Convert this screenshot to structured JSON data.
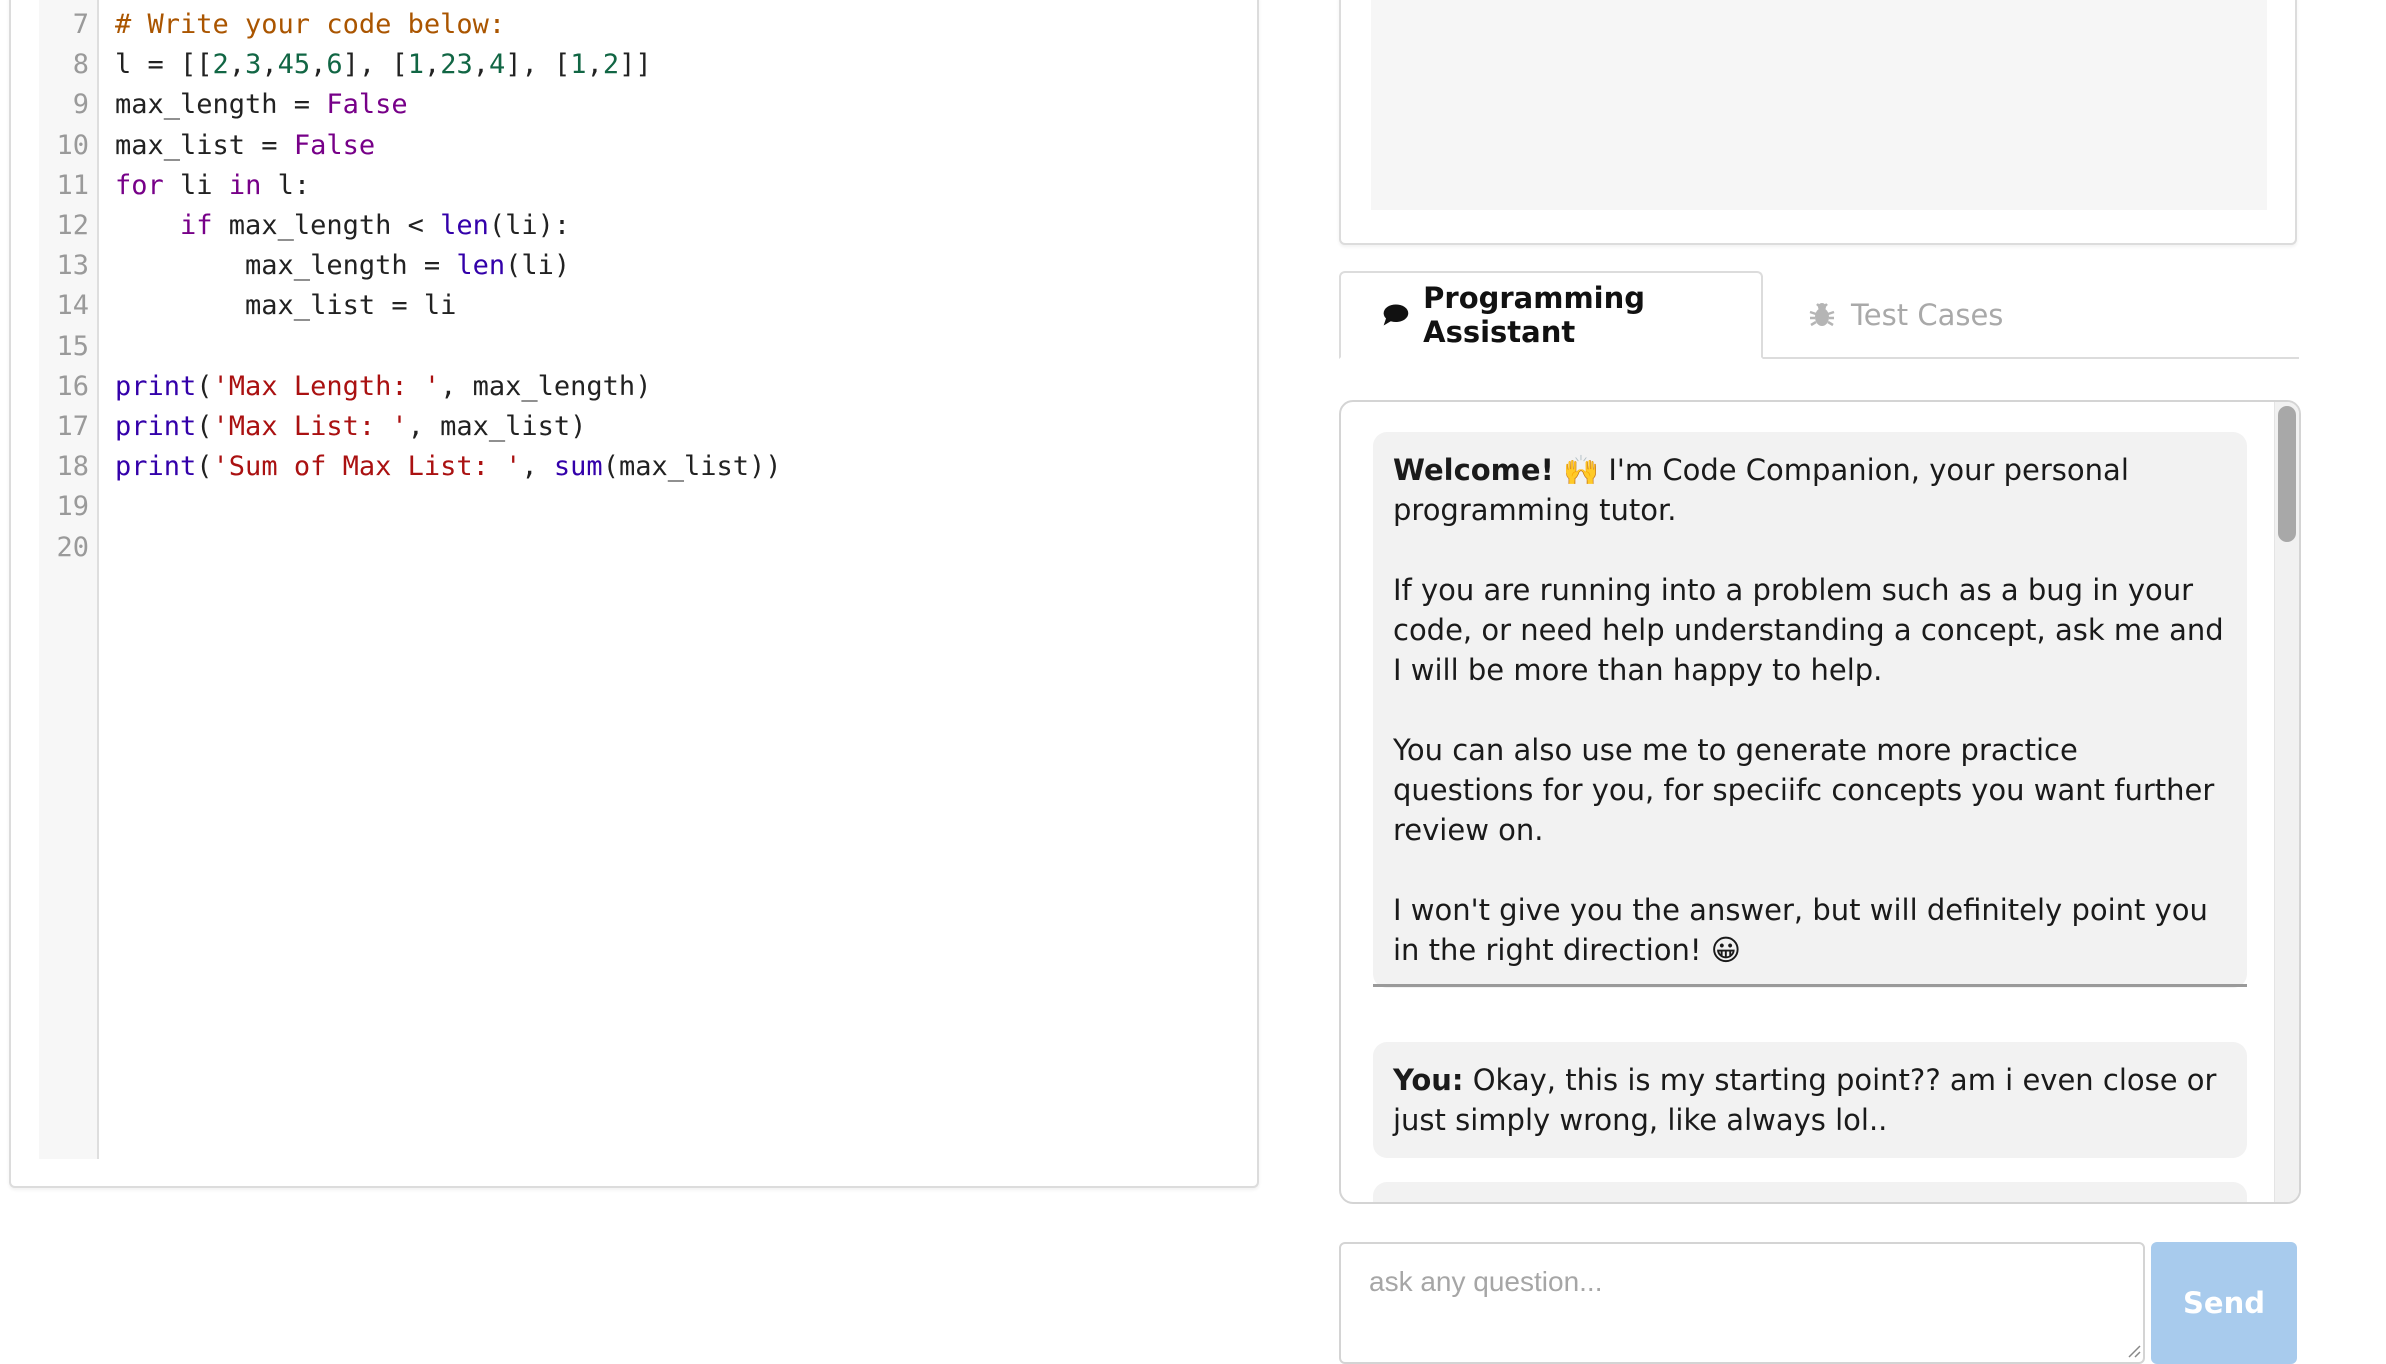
{
  "editor": {
    "lines": [
      {
        "n": "7",
        "tokens": [
          {
            "t": "# Write your code below:",
            "c": "comment"
          }
        ]
      },
      {
        "n": "8",
        "tokens": [
          {
            "t": "l = [[",
            "c": "var"
          },
          {
            "t": "2",
            "c": "number"
          },
          {
            "t": ",",
            "c": "var"
          },
          {
            "t": "3",
            "c": "number"
          },
          {
            "t": ",",
            "c": "var"
          },
          {
            "t": "45",
            "c": "number"
          },
          {
            "t": ",",
            "c": "var"
          },
          {
            "t": "6",
            "c": "number"
          },
          {
            "t": "], [",
            "c": "var"
          },
          {
            "t": "1",
            "c": "number"
          },
          {
            "t": ",",
            "c": "var"
          },
          {
            "t": "23",
            "c": "number"
          },
          {
            "t": ",",
            "c": "var"
          },
          {
            "t": "4",
            "c": "number"
          },
          {
            "t": "], [",
            "c": "var"
          },
          {
            "t": "1",
            "c": "number"
          },
          {
            "t": ",",
            "c": "var"
          },
          {
            "t": "2",
            "c": "number"
          },
          {
            "t": "]]",
            "c": "var"
          }
        ]
      },
      {
        "n": "9",
        "tokens": [
          {
            "t": "max_length = ",
            "c": "var"
          },
          {
            "t": "False",
            "c": "keyword"
          }
        ]
      },
      {
        "n": "10",
        "tokens": [
          {
            "t": "max_list = ",
            "c": "var"
          },
          {
            "t": "False",
            "c": "keyword"
          }
        ]
      },
      {
        "n": "11",
        "tokens": [
          {
            "t": "for",
            "c": "keyword"
          },
          {
            "t": " li ",
            "c": "var"
          },
          {
            "t": "in",
            "c": "keyword"
          },
          {
            "t": " l:",
            "c": "var"
          }
        ]
      },
      {
        "n": "12",
        "tokens": [
          {
            "t": "    ",
            "c": "var"
          },
          {
            "t": "if",
            "c": "keyword"
          },
          {
            "t": " max_length < ",
            "c": "var"
          },
          {
            "t": "len",
            "c": "builtin"
          },
          {
            "t": "(li):",
            "c": "var"
          }
        ]
      },
      {
        "n": "13",
        "tokens": [
          {
            "t": "        max_length = ",
            "c": "var"
          },
          {
            "t": "len",
            "c": "builtin"
          },
          {
            "t": "(li)",
            "c": "var"
          }
        ]
      },
      {
        "n": "14",
        "tokens": [
          {
            "t": "        max_list = li",
            "c": "var"
          }
        ]
      },
      {
        "n": "15",
        "tokens": []
      },
      {
        "n": "16",
        "tokens": [
          {
            "t": "print",
            "c": "builtin"
          },
          {
            "t": "(",
            "c": "var"
          },
          {
            "t": "'Max Length: '",
            "c": "string"
          },
          {
            "t": ", max_length)",
            "c": "var"
          }
        ]
      },
      {
        "n": "17",
        "tokens": [
          {
            "t": "print",
            "c": "builtin"
          },
          {
            "t": "(",
            "c": "var"
          },
          {
            "t": "'Max List: '",
            "c": "string"
          },
          {
            "t": ", max_list)",
            "c": "var"
          }
        ]
      },
      {
        "n": "18",
        "tokens": [
          {
            "t": "print",
            "c": "builtin"
          },
          {
            "t": "(",
            "c": "var"
          },
          {
            "t": "'Sum of Max List: '",
            "c": "string"
          },
          {
            "t": ", ",
            "c": "var"
          },
          {
            "t": "sum",
            "c": "builtin"
          },
          {
            "t": "(max_list))",
            "c": "var"
          }
        ]
      },
      {
        "n": "19",
        "tokens": []
      },
      {
        "n": "20",
        "tokens": []
      }
    ]
  },
  "tabs": {
    "assistant": "Programming Assistant",
    "test_cases": "Test Cases"
  },
  "chat": {
    "welcome": {
      "bold": "Welcome!",
      "emoji_hands": "🙌",
      "intro": " I'm Code Companion, your personal programming tutor.",
      "p2": "If you are running into a problem such as a bug in your code, or need help understanding a concept, ask me and I will be more than happy to help.",
      "p3": "You can also use me to generate more practice questions for you, for speciifc concepts you want further review on.",
      "p4": "I won't give you the answer, but will definitely point you in the right direction!",
      "emoji_smile": "😀"
    },
    "user_msg": {
      "label": "You:",
      "text": " Okay, this is my starting point?? am i even close or just simply wrong, like always lol.."
    }
  },
  "input": {
    "placeholder": "ask any question..."
  },
  "send_label": "Send",
  "colors": {
    "accent_send": "#a8cbed",
    "comment": "#aa5500",
    "keyword": "#770088",
    "number": "#116644",
    "builtin": "#3300aa",
    "string": "#aa1111"
  }
}
